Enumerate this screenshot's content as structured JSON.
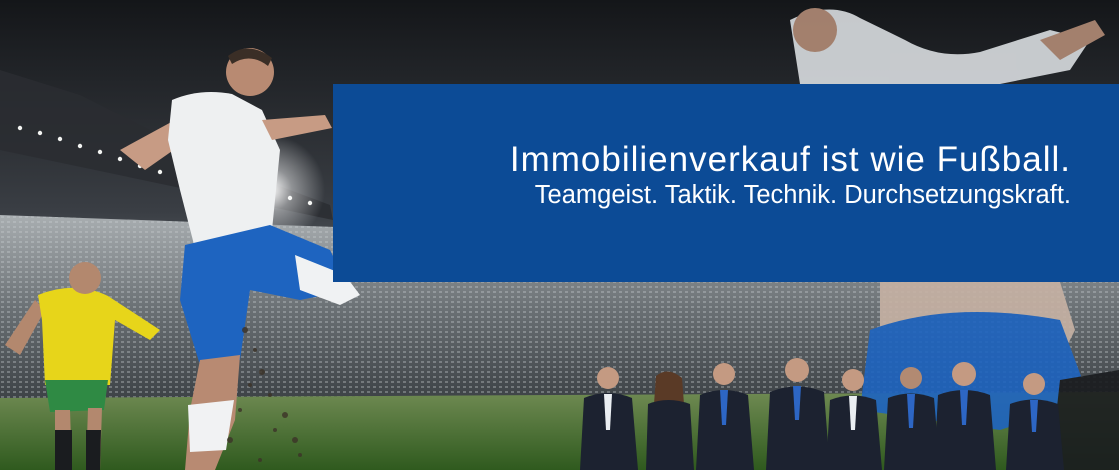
{
  "colors": {
    "headline_box": "#0c4b96",
    "headline_text": "#ffffff",
    "sky": "#2b2e33",
    "pitch": "#3f6a2c",
    "player_shirt_white": "#e9ecee",
    "player_shorts_blue": "#1e64c0",
    "player_shirt_yellow": "#e7d51a",
    "suit": "#1c2230"
  },
  "banner": {
    "headline": "Immobilienverkauf ist wie Fußball.",
    "subline": "Teamgeist. Taktik. Technik. Durchsetzungskraft."
  },
  "team": {
    "member_count": 8
  }
}
